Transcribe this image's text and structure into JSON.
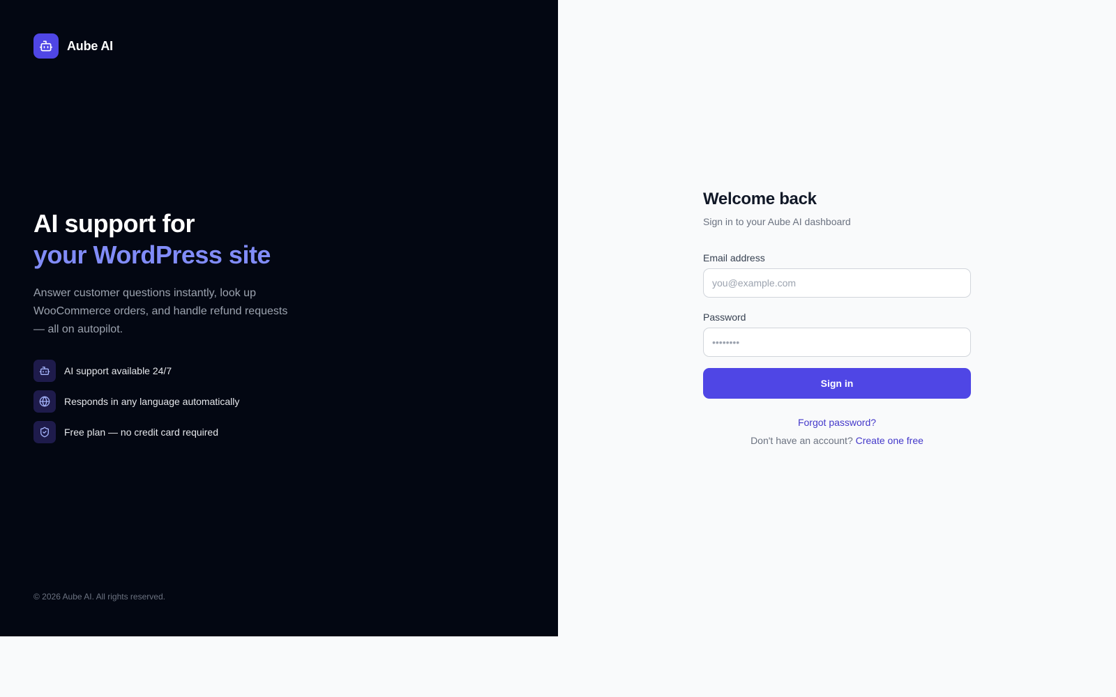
{
  "brand": {
    "name": "Aube AI",
    "icon": "bot-icon",
    "accent": "#4f46e5"
  },
  "hero": {
    "title_line1": "AI support for",
    "title_line2": "your WordPress site",
    "description": "Answer customer questions instantly, look up WooCommerce orders, and handle refund requests — all on autopilot."
  },
  "features": [
    {
      "icon": "bot-icon",
      "text": "AI support available 24/7"
    },
    {
      "icon": "globe-icon",
      "text": "Responds in any language automatically"
    },
    {
      "icon": "shield-icon",
      "text": "Free plan — no credit card required"
    }
  ],
  "footer": {
    "copyright": "© 2026 Aube AI. All rights reserved."
  },
  "form": {
    "title": "Welcome back",
    "subtitle": "Sign in to your Aube AI dashboard",
    "email": {
      "label": "Email address",
      "placeholder": "you@example.com",
      "value": ""
    },
    "password": {
      "label": "Password",
      "placeholder": "••••••••",
      "value": ""
    },
    "submit_label": "Sign in",
    "forgot_label": "Forgot password?",
    "signup_prompt": "Don't have an account?",
    "signup_link": "Create one free"
  }
}
